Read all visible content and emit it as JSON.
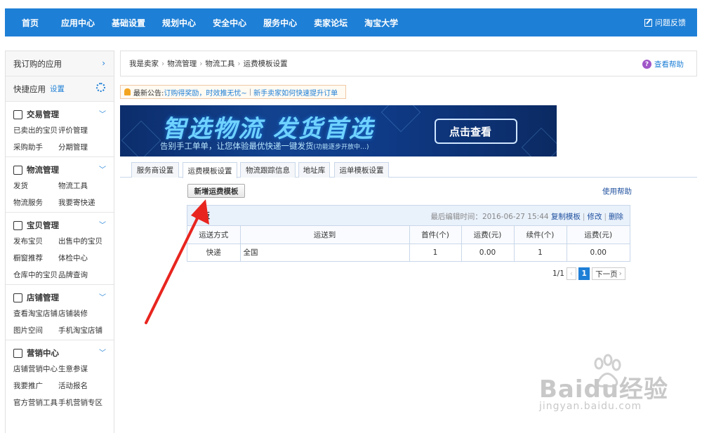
{
  "topnav": {
    "items": [
      "首页",
      "应用中心",
      "基础设置",
      "规划中心",
      "安全中心",
      "服务中心",
      "卖家论坛",
      "淘宝大学"
    ],
    "feedback": "问题反馈"
  },
  "sidebar": {
    "subscribed": "我订购的应用",
    "quick": "快捷应用",
    "quick_setting": "设置",
    "groups": [
      {
        "title": "交易管理",
        "links": [
          "已卖出的宝贝",
          "评价管理",
          "采购助手",
          "分期管理"
        ]
      },
      {
        "title": "物流管理",
        "links": [
          "发货",
          "物流工具",
          "物流服务",
          "我要寄快递"
        ]
      },
      {
        "title": "宝贝管理",
        "links": [
          "发布宝贝",
          "出售中的宝贝",
          "橱窗推荐",
          "体检中心",
          "仓库中的宝贝",
          "品牌查询"
        ]
      },
      {
        "title": "店铺管理",
        "links": [
          "查看淘宝店铺",
          "店铺装修",
          "图片空间",
          "手机淘宝店铺"
        ]
      },
      {
        "title": "营销中心",
        "links": [
          "店铺营销中心",
          "生意参谋",
          "我要推广",
          "活动报名",
          "官方营销工具",
          "手机营销专区"
        ]
      }
    ]
  },
  "breadcrumb": {
    "items": [
      "我是卖家",
      "物流管理",
      "物流工具",
      "运费模板设置"
    ],
    "help": "查看帮助"
  },
  "notice": {
    "label": "最新公告:",
    "link1": "订购得奖励，时效推无忧~",
    "sep": "|",
    "link2": "新手卖家如何快速提升订单"
  },
  "banner": {
    "title": "智选物流 发货首选",
    "subtitle": "告别手工单单，让您体验最优快递一键发货",
    "subtitle_note": "(功能逐步开放中…)",
    "cta": "点击查看"
  },
  "tabs": [
    "服务商设置",
    "运费模板设置",
    "物流跟踪信息",
    "地址库",
    "运单模板设置"
  ],
  "active_tab": "运费模板设置",
  "add_button": "新增运费模板",
  "use_help": "使用帮助",
  "template": {
    "name": "模板",
    "last_edit_label": "最后编辑时间：",
    "last_edit_time": "2016-06-27 15:44",
    "actions": [
      "复制模板",
      "修改",
      "删除"
    ],
    "columns": [
      "运送方式",
      "运送到",
      "首件(个)",
      "运费(元)",
      "续件(个)",
      "运费(元)"
    ],
    "rows": [
      [
        "快递",
        "全国",
        "1",
        "0.00",
        "1",
        "0.00"
      ]
    ]
  },
  "pager": {
    "page_info": "1/1",
    "prev": "‹",
    "current": "1",
    "next": "下一页",
    "next_arrow": "›"
  },
  "watermark": {
    "brand": "Baidu经验",
    "url": "jingyan.baidu.com"
  },
  "colors": {
    "nav": "#1e7fd6",
    "link": "#1e4f9e",
    "arrow": "#e8251f"
  }
}
